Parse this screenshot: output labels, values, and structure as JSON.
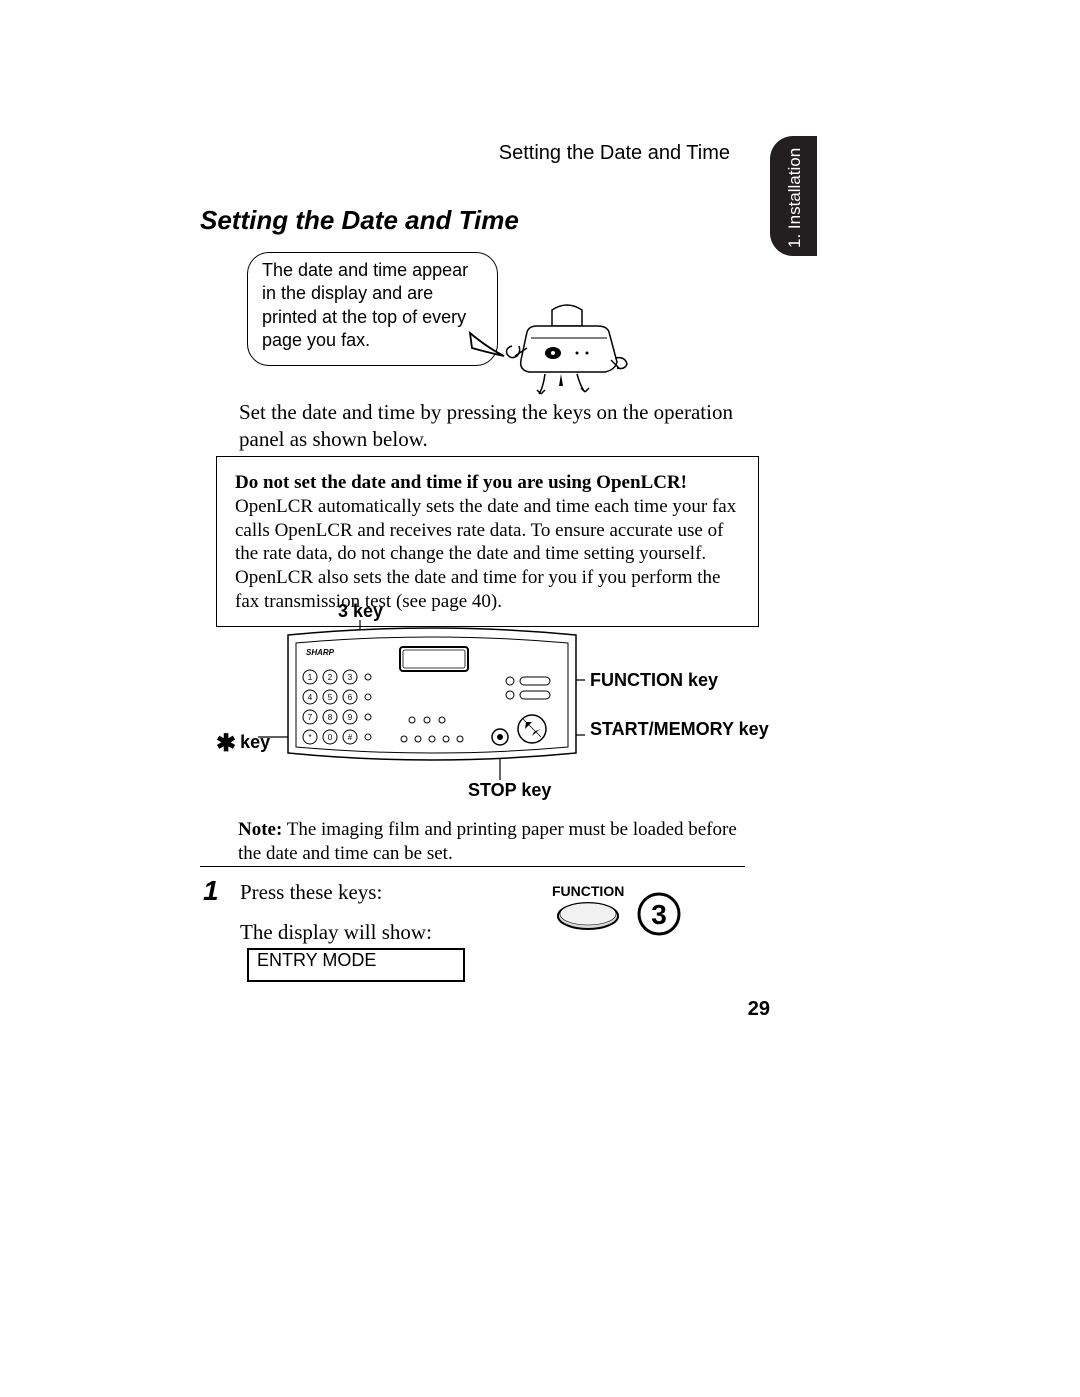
{
  "header": {
    "running_title": "Setting the Date and Time",
    "tab_label": "1. Installation"
  },
  "section_title": "Setting the Date and Time",
  "bubble_text": "The date and time appear in the display and are printed at the top of every page you fax.",
  "intro_para": "Set the date and time by pressing the keys on the operation panel as shown below.",
  "warning": {
    "title": "Do not set the date and time if you are using OpenLCR!",
    "body": "OpenLCR automatically sets the date and time each time your fax calls OpenLCR and receives rate data. To ensure accurate use of the rate data, do not change the date and time setting yourself. OpenLCR also sets the date and time for you if you perform the fax transmission test (see page 40)."
  },
  "panel_labels": {
    "key3": "3 key",
    "star": "key",
    "function": "FUNCTION key",
    "start_memory": "START/MEMORY key",
    "stop": "STOP key"
  },
  "panel_brand": "SHARP",
  "keypad": {
    "row1": [
      "1",
      "2",
      "3"
    ],
    "row2": [
      "4",
      "5",
      "6"
    ],
    "row3": [
      "7",
      "8",
      "9"
    ],
    "row4": [
      "*",
      "0",
      "#"
    ]
  },
  "note": {
    "label": "Note:",
    "body": " The imaging film and printing paper must be loaded before the date and time can be set."
  },
  "step": {
    "number": "1",
    "line1": "Press these keys:",
    "line2": "The display will show:",
    "function_caption": "FUNCTION",
    "key_number": "3"
  },
  "lcd_text": "ENTRY MODE",
  "page_number": "29"
}
